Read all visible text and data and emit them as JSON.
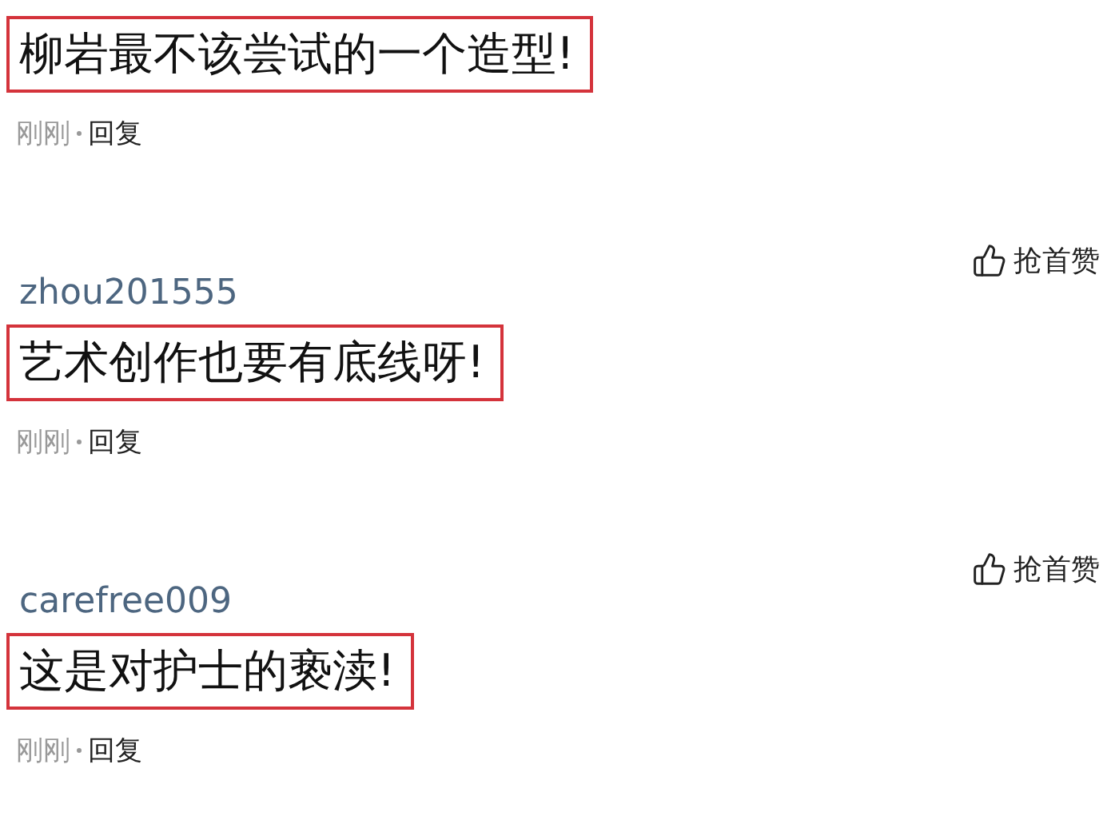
{
  "comments": [
    {
      "text": "柳岩最不该尝试的一个造型!",
      "highlighted": true,
      "time": "刚刚",
      "reply": "回复"
    },
    {
      "like": "抢首赞",
      "username": "zhou201555",
      "text": "艺术创作也要有底线呀!",
      "highlighted": true,
      "time": "刚刚",
      "reply": "回复"
    },
    {
      "like": "抢首赞",
      "username": "carefree009",
      "text": "这是对护士的亵渎!",
      "highlighted": true,
      "time": "刚刚",
      "reply": "回复"
    }
  ]
}
